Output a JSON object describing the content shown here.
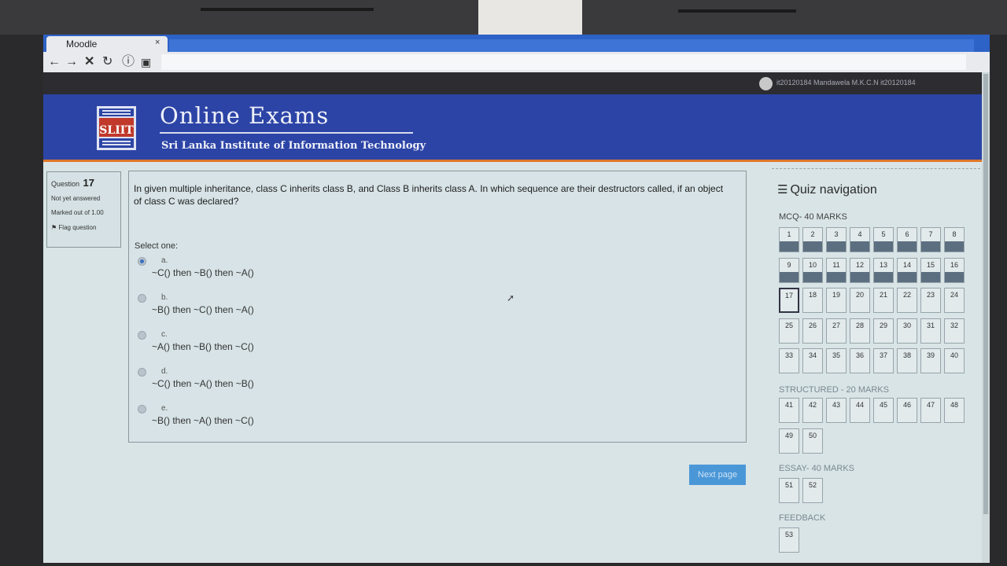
{
  "browser": {
    "tab_title": "Moodle",
    "tab_close": "×",
    "nav_icons": [
      "back-icon",
      "forward-icon",
      "stop-icon",
      "reload-icon",
      "info-icon",
      "page-icon"
    ]
  },
  "user": {
    "name": "it20120184 Mandawela M.K.C.N it20120184"
  },
  "banner": {
    "title": "Online Exams",
    "subtitle": "Sri Lanka Institute of Information Technology",
    "logo_text": "SLIIT"
  },
  "question_info": {
    "label": "Question",
    "number": "17",
    "state": "Not yet answered",
    "marked": "Marked out of 1.00",
    "flag": "Flag question"
  },
  "question": {
    "text": "In given multiple inheritance, class C inherits class B, and Class B inherits class A. In which sequence are their destructors called, if an object of class C was declared?",
    "select_label": "Select one:",
    "options": [
      {
        "letter": "a.",
        "text": "~C() then ~B() then ~A()",
        "checked": true
      },
      {
        "letter": "b.",
        "text": "~B() then ~C() then ~A()",
        "checked": false
      },
      {
        "letter": "c.",
        "text": "~A() then ~B() then ~C()",
        "checked": false
      },
      {
        "letter": "d.",
        "text": "~C() then ~A() then ~B()",
        "checked": false
      },
      {
        "letter": "e.",
        "text": "~B() then ~A() then ~C()",
        "checked": false
      }
    ]
  },
  "next_button": "Next page",
  "quiz_nav": {
    "title": "Quiz navigation",
    "sections": [
      {
        "label": "MCQ- 40 MARKS",
        "start": 1,
        "end": 40,
        "answered_upto": 16
      },
      {
        "label": "STRUCTURED - 20 MARKS",
        "start": 41,
        "end": 50,
        "answered_upto": 0
      },
      {
        "label": "ESSAY- 40 MARKS",
        "start": 51,
        "end": 52,
        "answered_upto": 0
      },
      {
        "label": "FEEDBACK",
        "start": 53,
        "end": 53,
        "answered_upto": 0
      }
    ],
    "current": 17
  },
  "colors": {
    "banner": "#2c44a6",
    "banner_accent": "#e0762a",
    "answered_bar": "#5c6f80",
    "next_button": "#4a97d8"
  }
}
